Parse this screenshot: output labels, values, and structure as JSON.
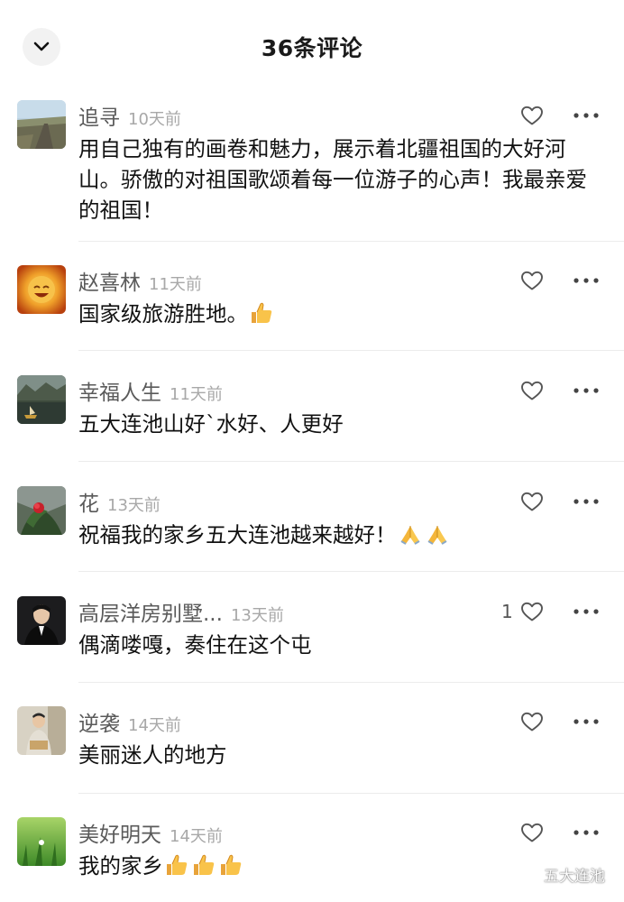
{
  "header": {
    "title": "36条评论",
    "collapse_icon": "chevron-down-icon"
  },
  "comments": [
    {
      "name": "追寻",
      "time": "10天前",
      "text": "用自己独有的画卷和魅力，展示着北疆祖国的大好河山。骄傲的对祖国歌颂着每一位游子的心声！我最亲爱的祖国！",
      "emoji": [],
      "likes": ""
    },
    {
      "name": "赵喜林",
      "time": "11天前",
      "text": "国家级旅游胜地。",
      "emoji": [
        "thumbs-up"
      ],
      "likes": ""
    },
    {
      "name": "幸福人生",
      "time": "11天前",
      "text": "五大连池山好`水好、人更好",
      "emoji": [],
      "likes": ""
    },
    {
      "name": "花",
      "time": "13天前",
      "text": "祝福我的家乡五大连池越来越好！",
      "emoji": [
        "folded-hands",
        "folded-hands"
      ],
      "likes": ""
    },
    {
      "name": "高层洋房别墅...",
      "time": "13天前",
      "text": "偶滴喽嘎，奏住在这个屯",
      "emoji": [],
      "likes": "1"
    },
    {
      "name": "逆袭",
      "time": "14天前",
      "text": "美丽迷人的地方",
      "emoji": [],
      "likes": ""
    },
    {
      "name": "美好明天",
      "time": "14天前",
      "text": "我的家乡",
      "emoji": [
        "thumbs-up",
        "thumbs-up",
        "thumbs-up"
      ],
      "likes": ""
    }
  ],
  "icons": {
    "like": "heart-outline-icon",
    "more": "more-horizontal-icon",
    "thumbs_up": "thumbs-up-emoji",
    "folded_hands": "folded-hands-emoji"
  },
  "watermark": {
    "text": "五大连池",
    "icon": "wechat-icon"
  },
  "colors": {
    "name": "#5a5a5a",
    "time": "#a8a8a8",
    "body": "#111111",
    "divider": "#ececec"
  }
}
